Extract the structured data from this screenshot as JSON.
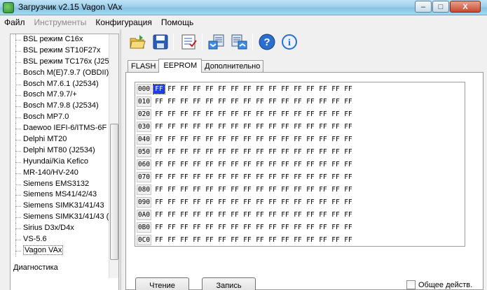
{
  "window": {
    "title": "Загрузчик v2.15 Vagon VAx",
    "buttons": {
      "minimize": "–",
      "maximize": "□",
      "close": "X"
    }
  },
  "menu": [
    {
      "label": "Файл",
      "enabled": true
    },
    {
      "label": "Инструменты",
      "enabled": false
    },
    {
      "label": "Конфигурация",
      "enabled": true
    },
    {
      "label": "Помощь",
      "enabled": true
    }
  ],
  "toolbar": {
    "icons": [
      "open-folder-icon",
      "save-disk-icon",
      "checklist-icon",
      "read-module-icon",
      "write-module-icon",
      "help-icon",
      "info-icon"
    ]
  },
  "tree": {
    "items": [
      "BSL режим C16x",
      "BSL режим ST10F27x",
      "BSL режим TC176x (J25",
      "Bosch M(E)7.9.7 (OBDII)",
      "Bosch M7.6.1 (J2534)",
      "Bosch M7.9.7/+",
      "Bosch M7.9.8 (J2534)",
      "Bosch MP7.0",
      "Daewoo IEFI-6/ITMS-6F",
      "Delphi MT20",
      "Delphi MT80 (J2534)",
      "Hyundai/Kia Kefico",
      "MR-140/HV-240",
      "Siemens EMS3132",
      "Siemens MS41/42/43",
      "Siemens SIMK31/41/43",
      "Siemens SIMK31/41/43 (",
      "Sirius D3x/D4x",
      "VS-5.6",
      "Vagon VAx"
    ],
    "selected_index": 19,
    "root_label": "Диагностика"
  },
  "tabs": [
    {
      "label": "FLASH",
      "active": false
    },
    {
      "label": "EEPROM",
      "active": true
    },
    {
      "label": "Дополнительно",
      "active": false
    }
  ],
  "hex": {
    "addresses": [
      "000",
      "010",
      "020",
      "030",
      "040",
      "050",
      "060",
      "070",
      "080",
      "090",
      "0A0",
      "0B0",
      "0C0"
    ],
    "byte_value": "FF",
    "bytes_per_row": 16,
    "selected_cell": {
      "row": 0,
      "col": 0
    }
  },
  "buttons": {
    "read": "Чтение",
    "write": "Запись"
  },
  "checkbox": {
    "label": "Общее действ.",
    "checked": false
  },
  "colors": {
    "selection": "#1c3cf0",
    "titlebar": "#9fd0ea"
  }
}
